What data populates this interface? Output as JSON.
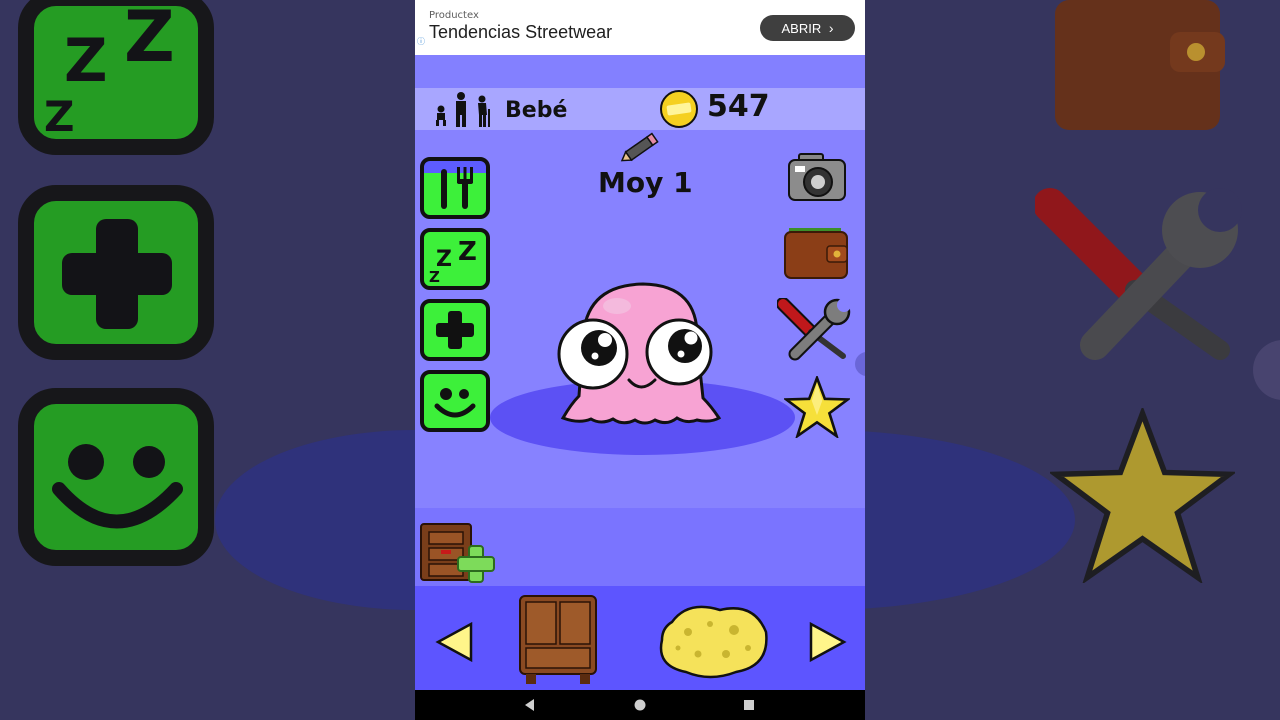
{
  "ad": {
    "source": "Productex",
    "title": "Tendencias Streetwear",
    "cta": "ABRIR",
    "info_icon": "info-icon"
  },
  "status": {
    "age_stage": "Bebé",
    "coins": "547"
  },
  "pet": {
    "name": "Moy 1"
  },
  "left_menu": [
    {
      "icon": "fork-knife-icon",
      "action": "food"
    },
    {
      "icon": "sleep-zzz-icon",
      "action": "sleep"
    },
    {
      "icon": "plus-health-icon",
      "action": "health"
    },
    {
      "icon": "smiley-icon",
      "action": "mood"
    }
  ],
  "right_menu": [
    {
      "icon": "camera-icon"
    },
    {
      "icon": "wallet-icon"
    },
    {
      "icon": "tools-icon"
    },
    {
      "icon": "star-icon"
    }
  ],
  "bottom": {
    "items": [
      "prev-arrow-icon",
      "wardrobe-icon",
      "sponge-icon",
      "next-arrow-icon"
    ]
  },
  "colors": {
    "stage": "#8782ff",
    "green_button": "#3df03a",
    "bottom_bar": "#5d55ff",
    "pet_pink": "#f7a3d3"
  }
}
